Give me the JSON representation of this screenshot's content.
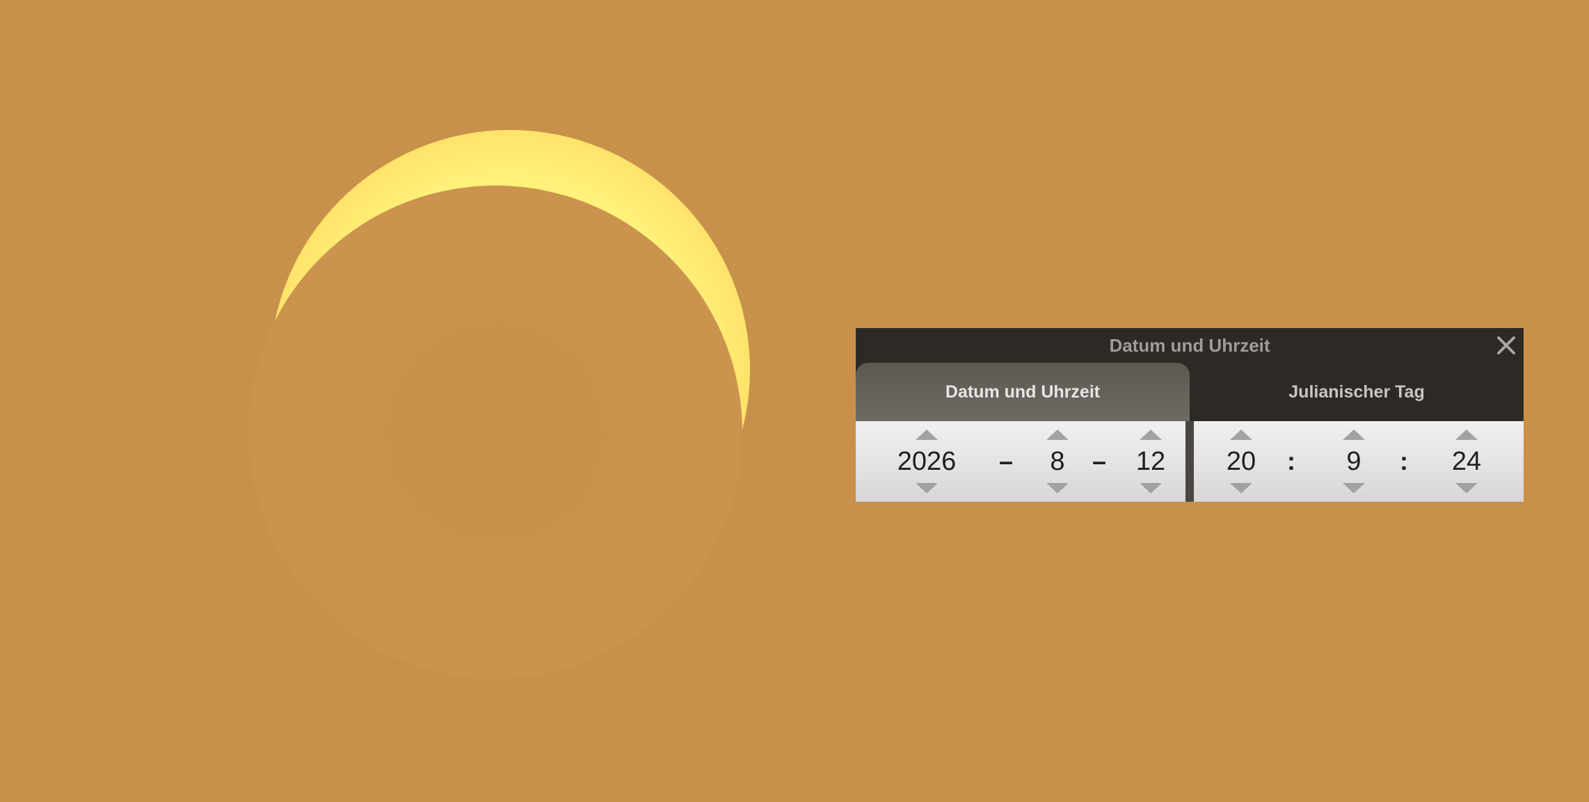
{
  "dialog": {
    "title": "Datum und Uhrzeit",
    "close_icon": "close-icon"
  },
  "tabs": [
    {
      "label": "Datum und Uhrzeit",
      "active": true
    },
    {
      "label": "Julianischer Tag",
      "active": false
    }
  ],
  "date": {
    "year": "2026",
    "month": "8",
    "day": "12",
    "separator": "–"
  },
  "time": {
    "hour": "20",
    "minute": "9",
    "second": "24",
    "separator": ":"
  },
  "colors": {
    "sky": "#c8914b",
    "sun": "#fff27a",
    "dialog_bg": "#2d2a26"
  }
}
